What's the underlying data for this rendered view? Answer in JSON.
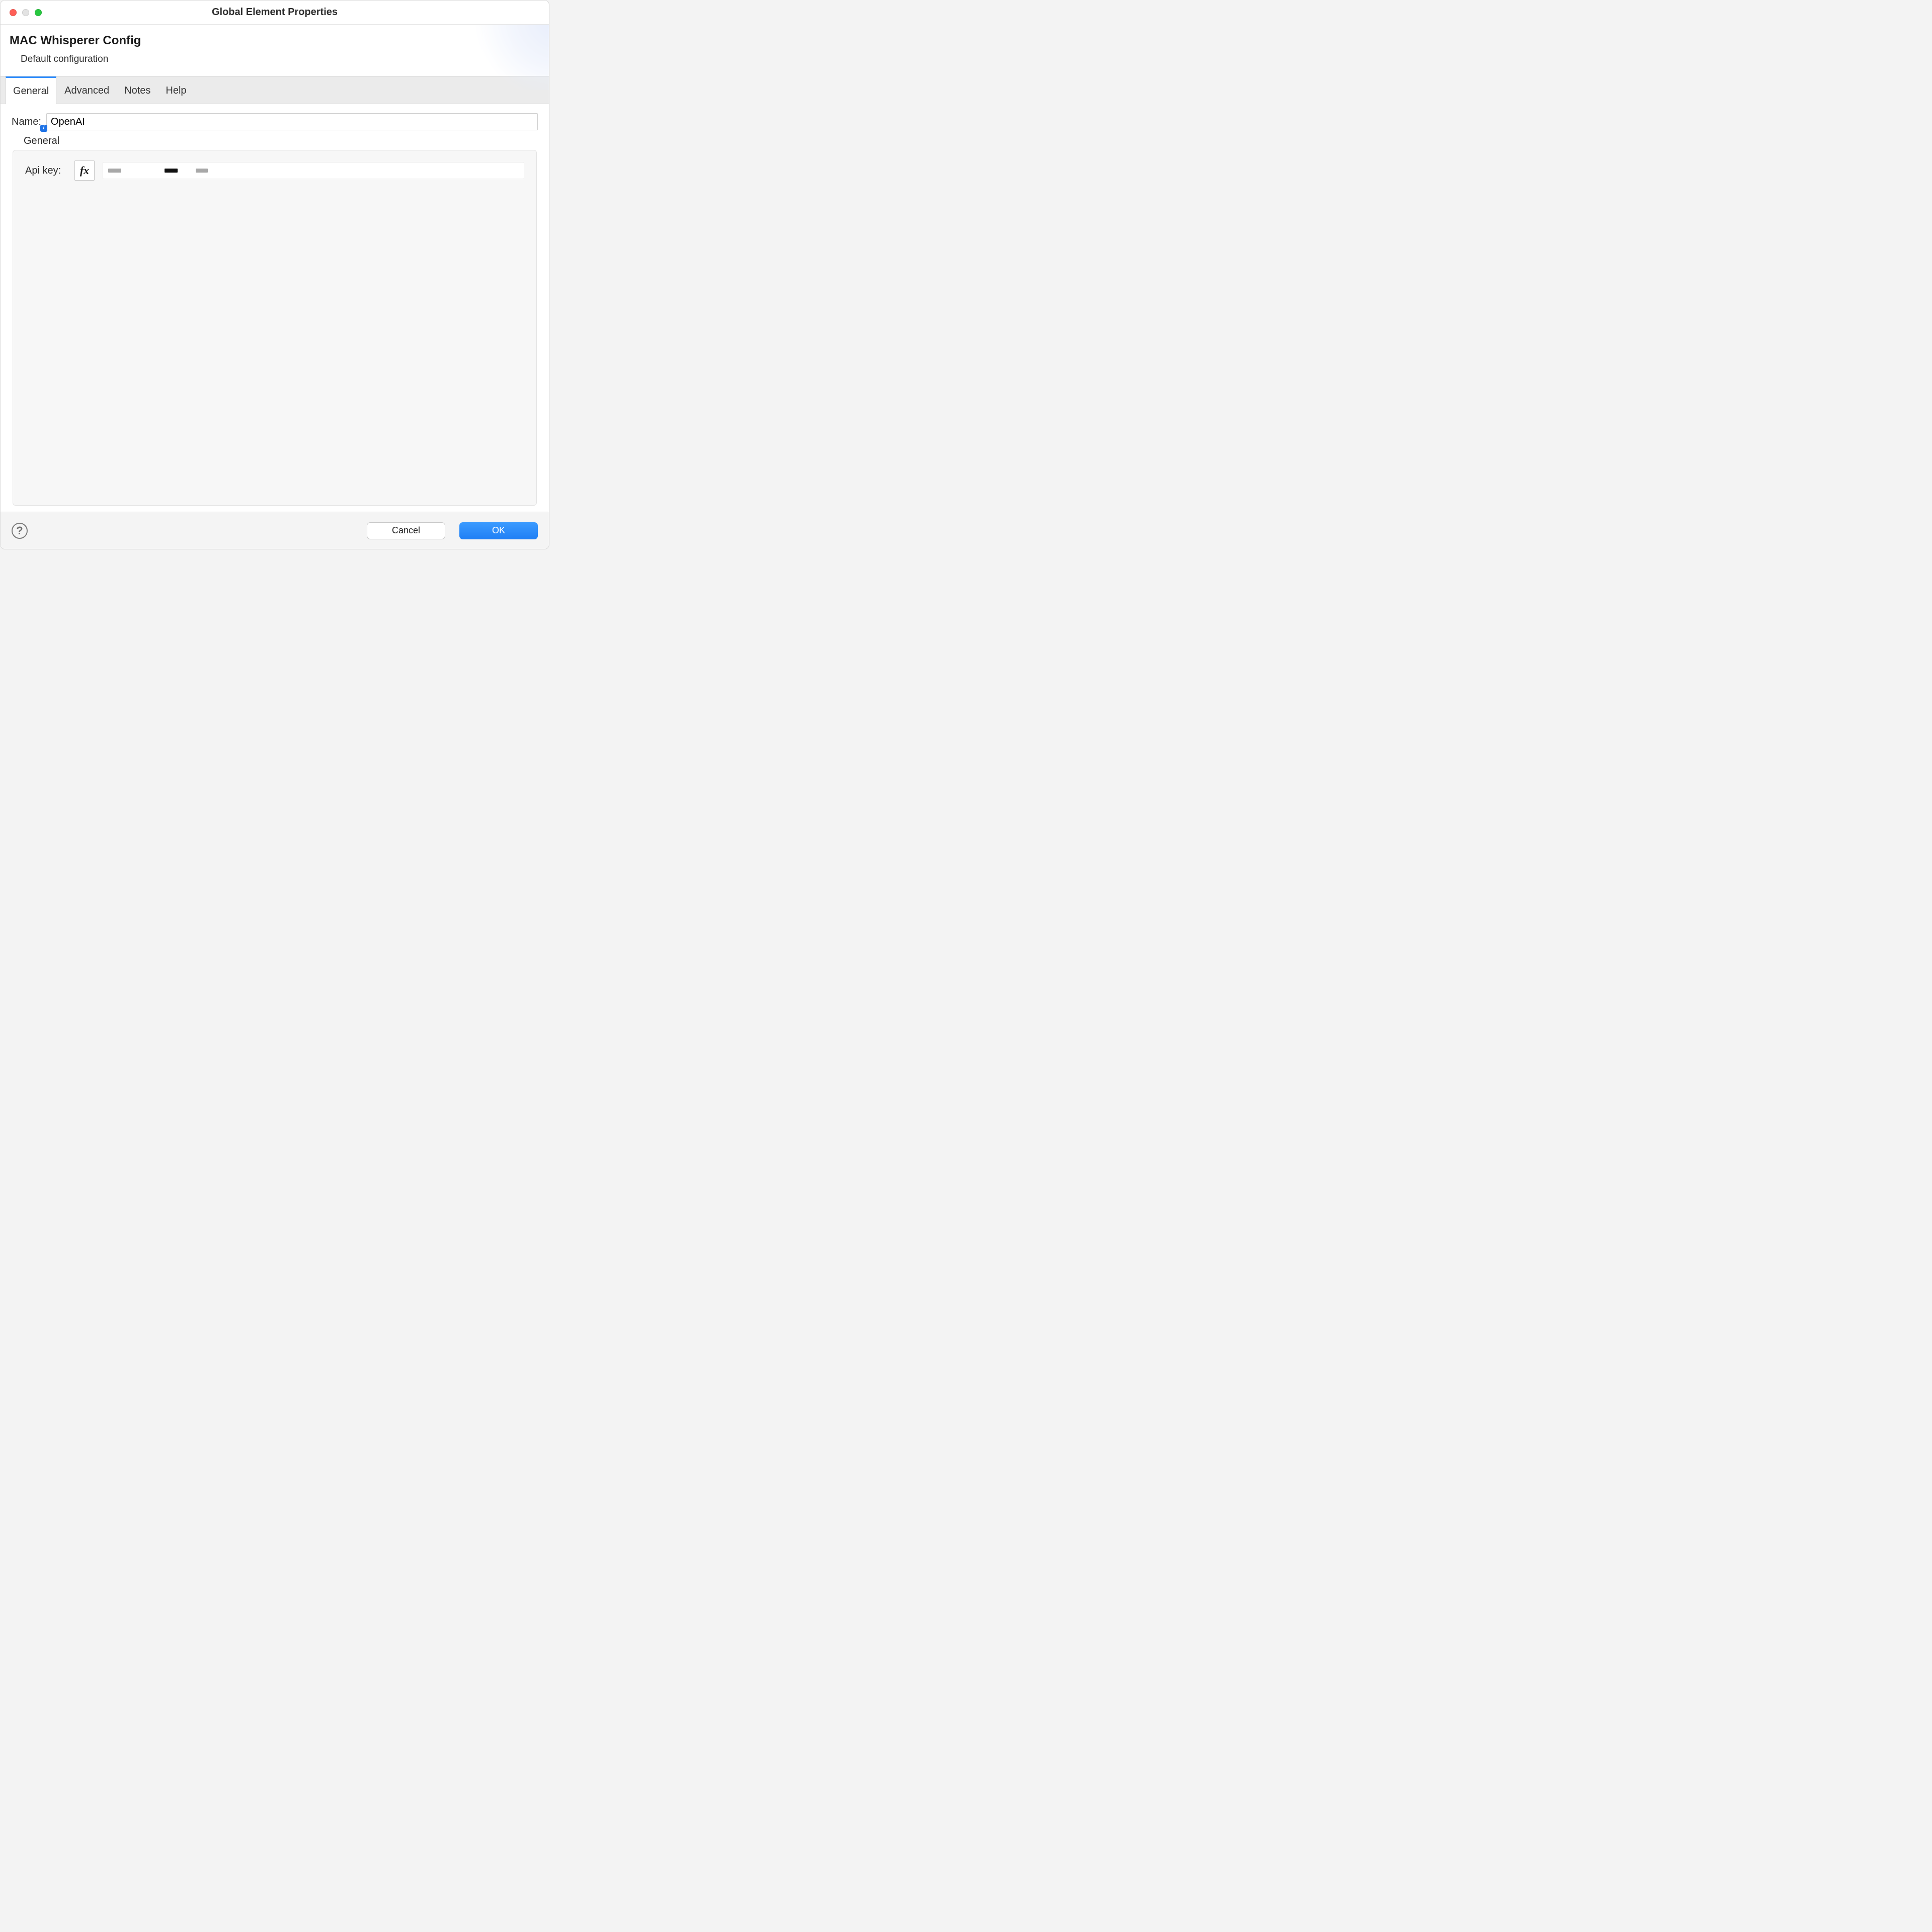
{
  "window": {
    "title": "Global Element Properties"
  },
  "header": {
    "title": "MAC Whisperer Config",
    "subtitle": "Default configuration"
  },
  "tabs": [
    {
      "label": "General",
      "active": true
    },
    {
      "label": "Advanced",
      "active": false
    },
    {
      "label": "Notes",
      "active": false
    },
    {
      "label": "Help",
      "active": false
    }
  ],
  "form": {
    "name_label": "Name:",
    "name_value": "OpenAI",
    "section_label": "General",
    "api_key_label": "Api key:",
    "fx_label": "fx",
    "api_key_value": ""
  },
  "footer": {
    "help_tooltip": "Help",
    "cancel_label": "Cancel",
    "ok_label": "OK"
  },
  "info_badge": "i"
}
